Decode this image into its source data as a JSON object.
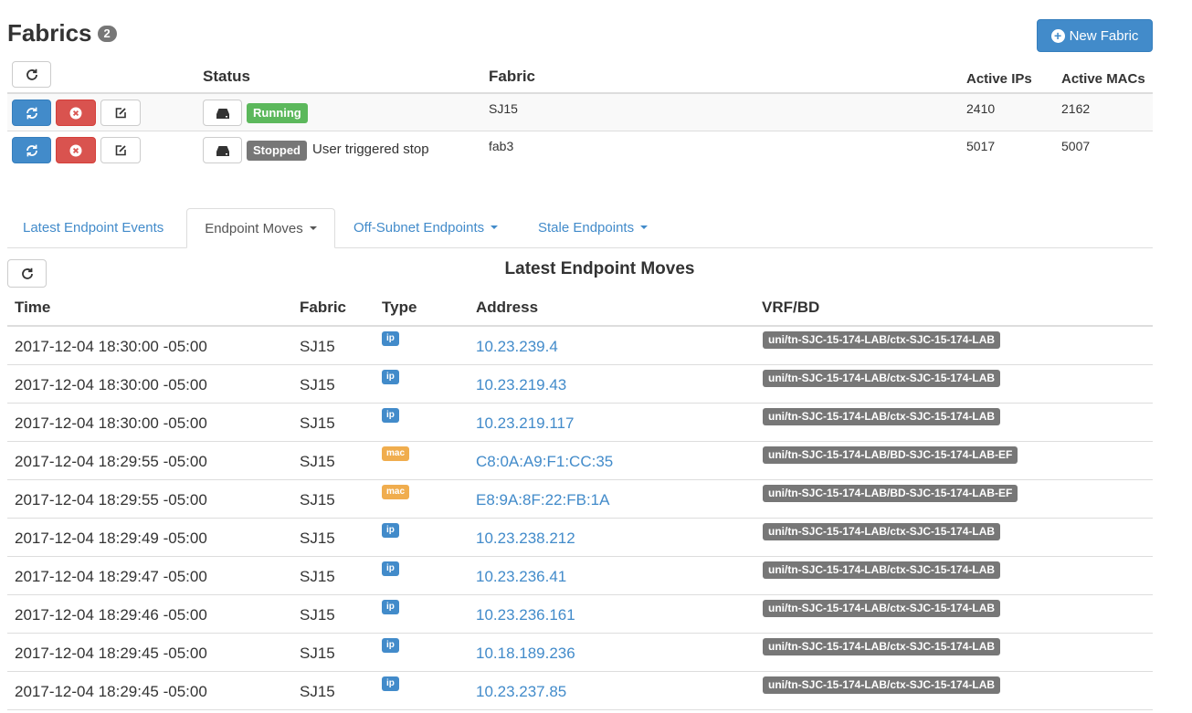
{
  "header": {
    "title": "Fabrics",
    "count": "2",
    "new_fabric_label": "New Fabric"
  },
  "fabric_table": {
    "headers": {
      "status": "Status",
      "fabric": "Fabric",
      "active_ips": "Active IPs",
      "active_macs": "Active MACs"
    },
    "rows": [
      {
        "status_label": "Running",
        "status_color": "#5cb85c",
        "status_message": "",
        "fabric": "SJ15",
        "active_ips": "2410",
        "active_macs": "2162"
      },
      {
        "status_label": "Stopped",
        "status_color": "#777777",
        "status_message": "User triggered stop",
        "fabric": "fab3",
        "active_ips": "5017",
        "active_macs": "5007"
      }
    ]
  },
  "tabs": [
    {
      "label": "Latest Endpoint Events",
      "active": false,
      "dropdown": false
    },
    {
      "label": "Endpoint Moves",
      "active": true,
      "dropdown": true
    },
    {
      "label": "Off-Subnet Endpoints",
      "active": false,
      "dropdown": true
    },
    {
      "label": "Stale Endpoints",
      "active": false,
      "dropdown": true
    }
  ],
  "moves": {
    "title": "Latest Endpoint Moves",
    "headers": {
      "time": "Time",
      "fabric": "Fabric",
      "type": "Type",
      "address": "Address",
      "vrf_bd": "VRF/BD"
    },
    "rows": [
      {
        "time": "2017-12-04 18:30:00 -05:00",
        "fabric": "SJ15",
        "type": "ip",
        "address": "10.23.239.4",
        "vrf_bd": "uni/tn-SJC-15-174-LAB/ctx-SJC-15-174-LAB"
      },
      {
        "time": "2017-12-04 18:30:00 -05:00",
        "fabric": "SJ15",
        "type": "ip",
        "address": "10.23.219.43",
        "vrf_bd": "uni/tn-SJC-15-174-LAB/ctx-SJC-15-174-LAB"
      },
      {
        "time": "2017-12-04 18:30:00 -05:00",
        "fabric": "SJ15",
        "type": "ip",
        "address": "10.23.219.117",
        "vrf_bd": "uni/tn-SJC-15-174-LAB/ctx-SJC-15-174-LAB"
      },
      {
        "time": "2017-12-04 18:29:55 -05:00",
        "fabric": "SJ15",
        "type": "mac",
        "address": "C8:0A:A9:F1:CC:35",
        "vrf_bd": "uni/tn-SJC-15-174-LAB/BD-SJC-15-174-LAB-EF"
      },
      {
        "time": "2017-12-04 18:29:55 -05:00",
        "fabric": "SJ15",
        "type": "mac",
        "address": "E8:9A:8F:22:FB:1A",
        "vrf_bd": "uni/tn-SJC-15-174-LAB/BD-SJC-15-174-LAB-EF"
      },
      {
        "time": "2017-12-04 18:29:49 -05:00",
        "fabric": "SJ15",
        "type": "ip",
        "address": "10.23.238.212",
        "vrf_bd": "uni/tn-SJC-15-174-LAB/ctx-SJC-15-174-LAB"
      },
      {
        "time": "2017-12-04 18:29:47 -05:00",
        "fabric": "SJ15",
        "type": "ip",
        "address": "10.23.236.41",
        "vrf_bd": "uni/tn-SJC-15-174-LAB/ctx-SJC-15-174-LAB"
      },
      {
        "time": "2017-12-04 18:29:46 -05:00",
        "fabric": "SJ15",
        "type": "ip",
        "address": "10.23.236.161",
        "vrf_bd": "uni/tn-SJC-15-174-LAB/ctx-SJC-15-174-LAB"
      },
      {
        "time": "2017-12-04 18:29:45 -05:00",
        "fabric": "SJ15",
        "type": "ip",
        "address": "10.18.189.236",
        "vrf_bd": "uni/tn-SJC-15-174-LAB/ctx-SJC-15-174-LAB"
      },
      {
        "time": "2017-12-04 18:29:45 -05:00",
        "fabric": "SJ15",
        "type": "ip",
        "address": "10.23.237.85",
        "vrf_bd": "uni/tn-SJC-15-174-LAB/ctx-SJC-15-174-LAB"
      }
    ]
  },
  "colors": {
    "primary": "#428bca",
    "danger": "#d9534f",
    "success": "#5cb85c",
    "warning": "#f0ad4e",
    "default_label": "#777777"
  },
  "icons": {
    "refresh": "refresh-icon",
    "stop": "stop-circle-icon",
    "edit": "edit-icon",
    "drive": "hdd-icon",
    "plus": "plus-circle-icon"
  }
}
